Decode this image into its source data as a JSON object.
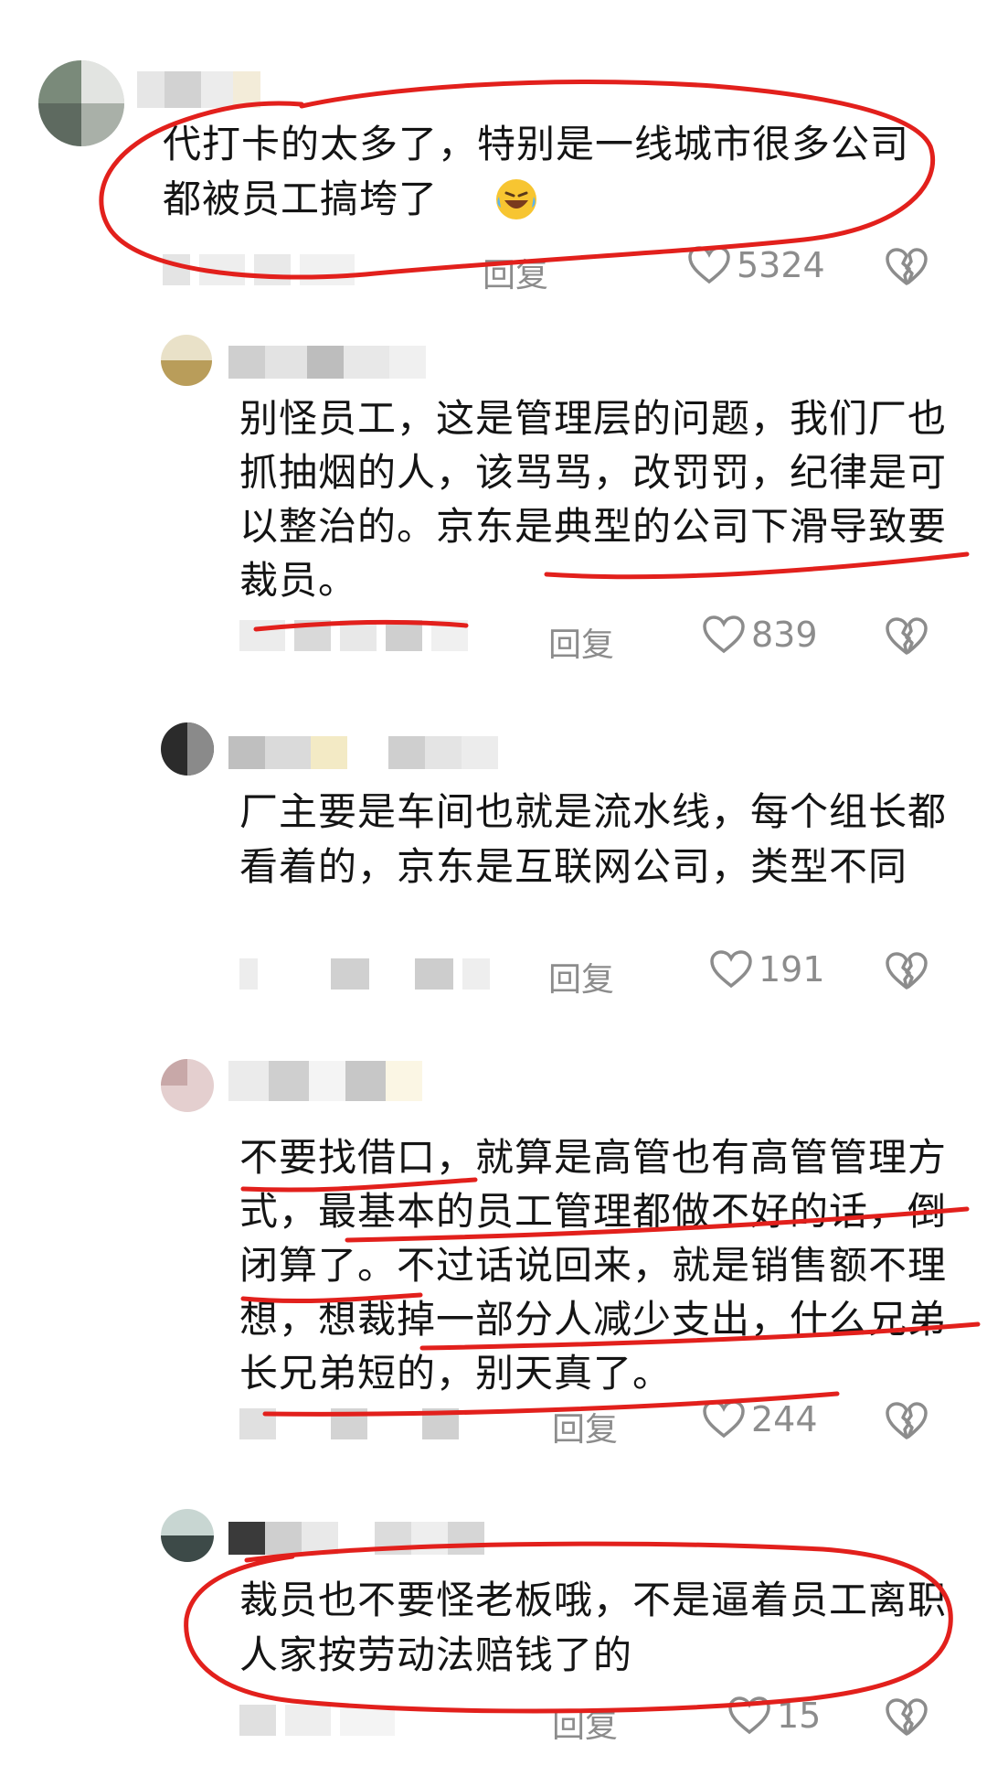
{
  "comments": [
    {
      "text": "代打卡的太多了，特别是一线城市很多公司都被员工搞垮了",
      "reply_label": "回复",
      "likes": "5324",
      "emoji": "rolling-on-floor-laughing-emoji"
    },
    {
      "text": "别怪员工，这是管理层的问题，我们厂也抓抽烟的人，该骂骂，改罚罚，纪律是可以整治的。京东是典型的公司下滑导致要裁员。",
      "reply_label": "回复",
      "likes": "839"
    },
    {
      "text": "厂主要是车间也就是流水线，每个组长都看着的，京东是互联网公司，类型不同",
      "reply_label": "回复",
      "likes": "191"
    },
    {
      "text": "不要找借口，就算是高管也有高管管理方式，最基本的员工管理都做不好的话，倒闭算了。不过话说回来，就是销售额不理想，想裁掉一部分人减少支出，什么兄弟长兄弟短的，别天真了。",
      "reply_label": "回复",
      "likes": "244"
    },
    {
      "text": "裁员也不要怪老板哦，不是逼着员工离职人家按劳动法赔钱了的",
      "reply_label": "回复",
      "likes": "15"
    }
  ],
  "icons": {
    "like": "heart-outline-icon",
    "dislike": "broken-heart-icon"
  },
  "colors": {
    "annotation_red": "#e2201c",
    "meta_gray": "#8c8c8c"
  }
}
